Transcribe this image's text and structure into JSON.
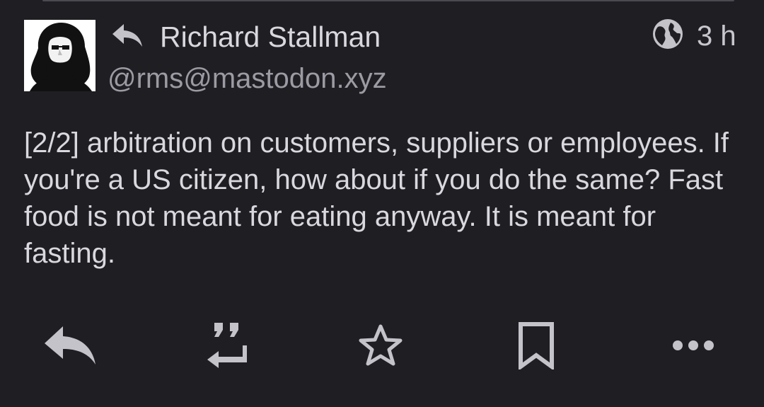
{
  "status": {
    "author": {
      "display_name": "Richard Stallman",
      "handle": "@rms@mastodon.xyz",
      "avatar_icon": "avatar-portrait"
    },
    "reply_indicator_icon": "reply-icon",
    "visibility_icon": "globe-icon",
    "timestamp": "3 h",
    "content": "[2/2] arbitration on customers, suppliers or employees. If you're a US citizen, how about if you do the same? Fast food is not meant for eating anyway. It is meant for fasting."
  },
  "actions": [
    {
      "name": "reply",
      "icon": "reply-icon"
    },
    {
      "name": "boost",
      "icon": "boost-icon"
    },
    {
      "name": "favourite",
      "icon": "star-icon"
    },
    {
      "name": "bookmark",
      "icon": "bookmark-icon"
    },
    {
      "name": "more",
      "icon": "more-icon"
    }
  ],
  "colors": {
    "background": "#1f1e23",
    "text_primary": "#d9d8de",
    "text_secondary": "#9c9ba3",
    "icon": "#c4c3ca"
  }
}
